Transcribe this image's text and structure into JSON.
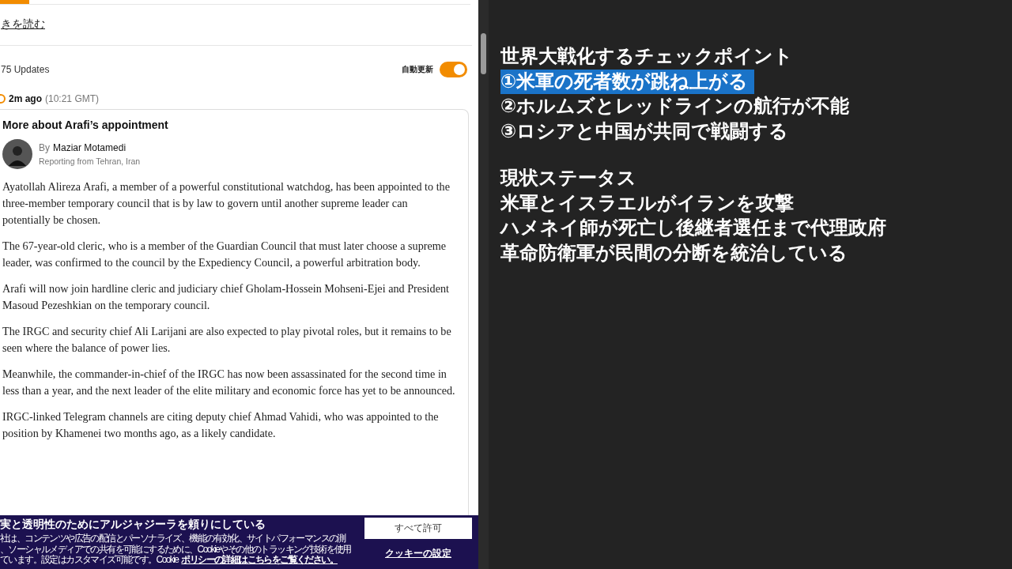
{
  "article_pane": {
    "read_more_link": "きを読む",
    "updates_count": "75 Updates",
    "auto_update": {
      "label": "自動更新",
      "on": true
    },
    "entry": {
      "time_ago": "2m ago",
      "time": "(10:21 GMT)",
      "title": "More about Arafi’s appointment",
      "byline_prefix": "By",
      "author": "Maziar Motamedi",
      "location": "Reporting from Tehran, Iran",
      "paragraphs": [
        "Ayatollah Alireza Arafi, a member of a powerful constitutional watchdog, has been appointed to the three-member temporary council that is by law to govern until another supreme leader can potentially be chosen.",
        "The 67-year-old cleric, who is a member of the Guardian Council that must later choose a supreme leader, was confirmed to the council by the Expediency Council, a powerful arbitration body.",
        "Arafi will now join hardline cleric and judiciary chief Gholam-Hossein Mohseni-Ejei and President Masoud Pezeshkian on the temporary council.",
        "The IRGC and security chief Ali Larijani are also expected to play pivotal roles, but it remains to be seen where the balance of power lies.",
        "Meanwhile, the commander-in-chief of the IRGC has now been assassinated for the second time in less than a year, and the next leader of the elite military and economic force has yet to be announced.",
        "IRGC-linked Telegram channels are citing deputy chief Ahmad Vahidi, who was appointed to the position by Khamenei two months ago, as a likely candidate."
      ]
    },
    "cookie_banner": {
      "title": "実と透明性のためにアルジャジーラを頼りにしている",
      "lines": [
        "社は、コンテンツや広告の配信とパーソナライズ、機能の有効化、サイトパフォーマンスの測",
        "、ソーシャルメディアでの共有を可能にするために、Cookieやその他のトラッキング技術を使用",
        "ています。設定はカスタマイズ可能です。Cookie"
      ],
      "policy_link": "ポリシーの詳細はこちらをご覧ください。",
      "accept_button": "すべて許可",
      "settings_link": "クッキーの設定"
    }
  },
  "notes_pane": {
    "groups": [
      {
        "lines": [
          {
            "text": "世界大戦化するチェックポイント",
            "selected": false
          },
          {
            "text": "①米軍の死者数が跳ね上がる",
            "selected": true
          },
          {
            "text": "②ホルムズとレッドラインの航行が不能",
            "selected": false
          },
          {
            "text": "③ロシアと中国が共同で戦闘する",
            "selected": false
          }
        ]
      },
      {
        "lines": [
          {
            "text": "現状ステータス",
            "selected": false
          },
          {
            "text": "米軍とイスラエルがイランを攻撃",
            "selected": false
          },
          {
            "text": "ハメネイ師が死亡し後継者選任まで代理政府",
            "selected": false
          },
          {
            "text": "革命防衛軍が民間の分断を統治している",
            "selected": false
          }
        ]
      }
    ]
  }
}
